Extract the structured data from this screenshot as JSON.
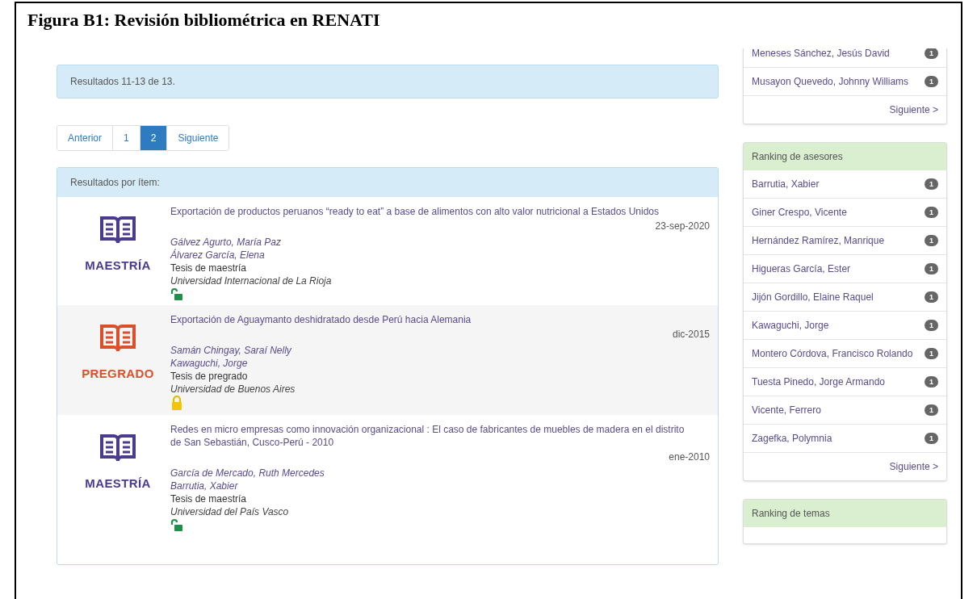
{
  "caption": "Figura B1: Revisión bibliométrica en RENATI",
  "results_summary": "Resultados 11-13 de 13.",
  "pagination": [
    {
      "label": "Anterior",
      "selected": false
    },
    {
      "label": "1",
      "selected": false
    },
    {
      "label": "2",
      "selected": true
    },
    {
      "label": "Siguiente",
      "selected": false
    }
  ],
  "results_panel": {
    "title": "Resultados por ítem:",
    "items": [
      {
        "kind": "maestria",
        "badge": "MAESTRÍA",
        "title": "Exportación de productos peruanos “ready to eat” a base de alimentos con alto valor nutricional a Estados Unidos",
        "date": "23-sep-2020",
        "authors": [
          "Gálvez Agurto, María Paz",
          "Álvarez García, Elena"
        ],
        "type": "Tesis de maestría",
        "institution": "Universidad Internacional de La Rioja",
        "open_access": true
      },
      {
        "kind": "pregrado",
        "badge": "PREGRADO",
        "title": "Exportación de Aguaymanto deshidratado desde Perú hacia Alemania",
        "date": "dic-2015",
        "authors": [
          "Samán Chingay, Saraí Nelly",
          "Kawaguchi, Jorge"
        ],
        "type": "Tesis de pregrado",
        "institution": "Universidad de Buenos Aires",
        "open_access": false
      },
      {
        "kind": "maestria",
        "badge": "MAESTRÍA",
        "title": "Redes en micro empresas como innovación organizacional : El caso de fabricantes de muebles de madera en el distrito de San Sebastián, Cusco-Perú - 2010",
        "date": "ene-2010",
        "authors": [
          "García de Mercado, Ruth Mercedes",
          "Barrutia, Xabier"
        ],
        "type": "Tesis de maestría",
        "institution": "Universidad del País Vasco",
        "open_access": true
      }
    ]
  },
  "sidebar": [
    {
      "items": [
        {
          "name": "Meneses Sánchez, Jesús David",
          "count": "1"
        },
        {
          "name": "Musayon Quevedo, Johnny Williams",
          "count": "1"
        }
      ],
      "next": "Siguiente >"
    },
    {
      "title": "Ranking de asesores",
      "items": [
        {
          "name": "Barrutia, Xabier",
          "count": "1"
        },
        {
          "name": "Giner Crespo, Vicente",
          "count": "1"
        },
        {
          "name": "Hernández Ramírez, Manrique",
          "count": "1"
        },
        {
          "name": "Higueras García, Ester",
          "count": "1"
        },
        {
          "name": "Jijón Gordillo, Elaine Raquel",
          "count": "1"
        },
        {
          "name": "Kawaguchi, Jorge",
          "count": "1"
        },
        {
          "name": "Montero Córdova, Francisco Rolando",
          "count": "1"
        },
        {
          "name": "Tuesta Pinedo, Jorge Armando",
          "count": "1"
        },
        {
          "name": "Vicente, Ferrero",
          "count": "1"
        },
        {
          "name": "Zagefka, Polymnia",
          "count": "1"
        }
      ],
      "next": "Siguiente >"
    },
    {
      "title": "Ranking de temas"
    }
  ]
}
